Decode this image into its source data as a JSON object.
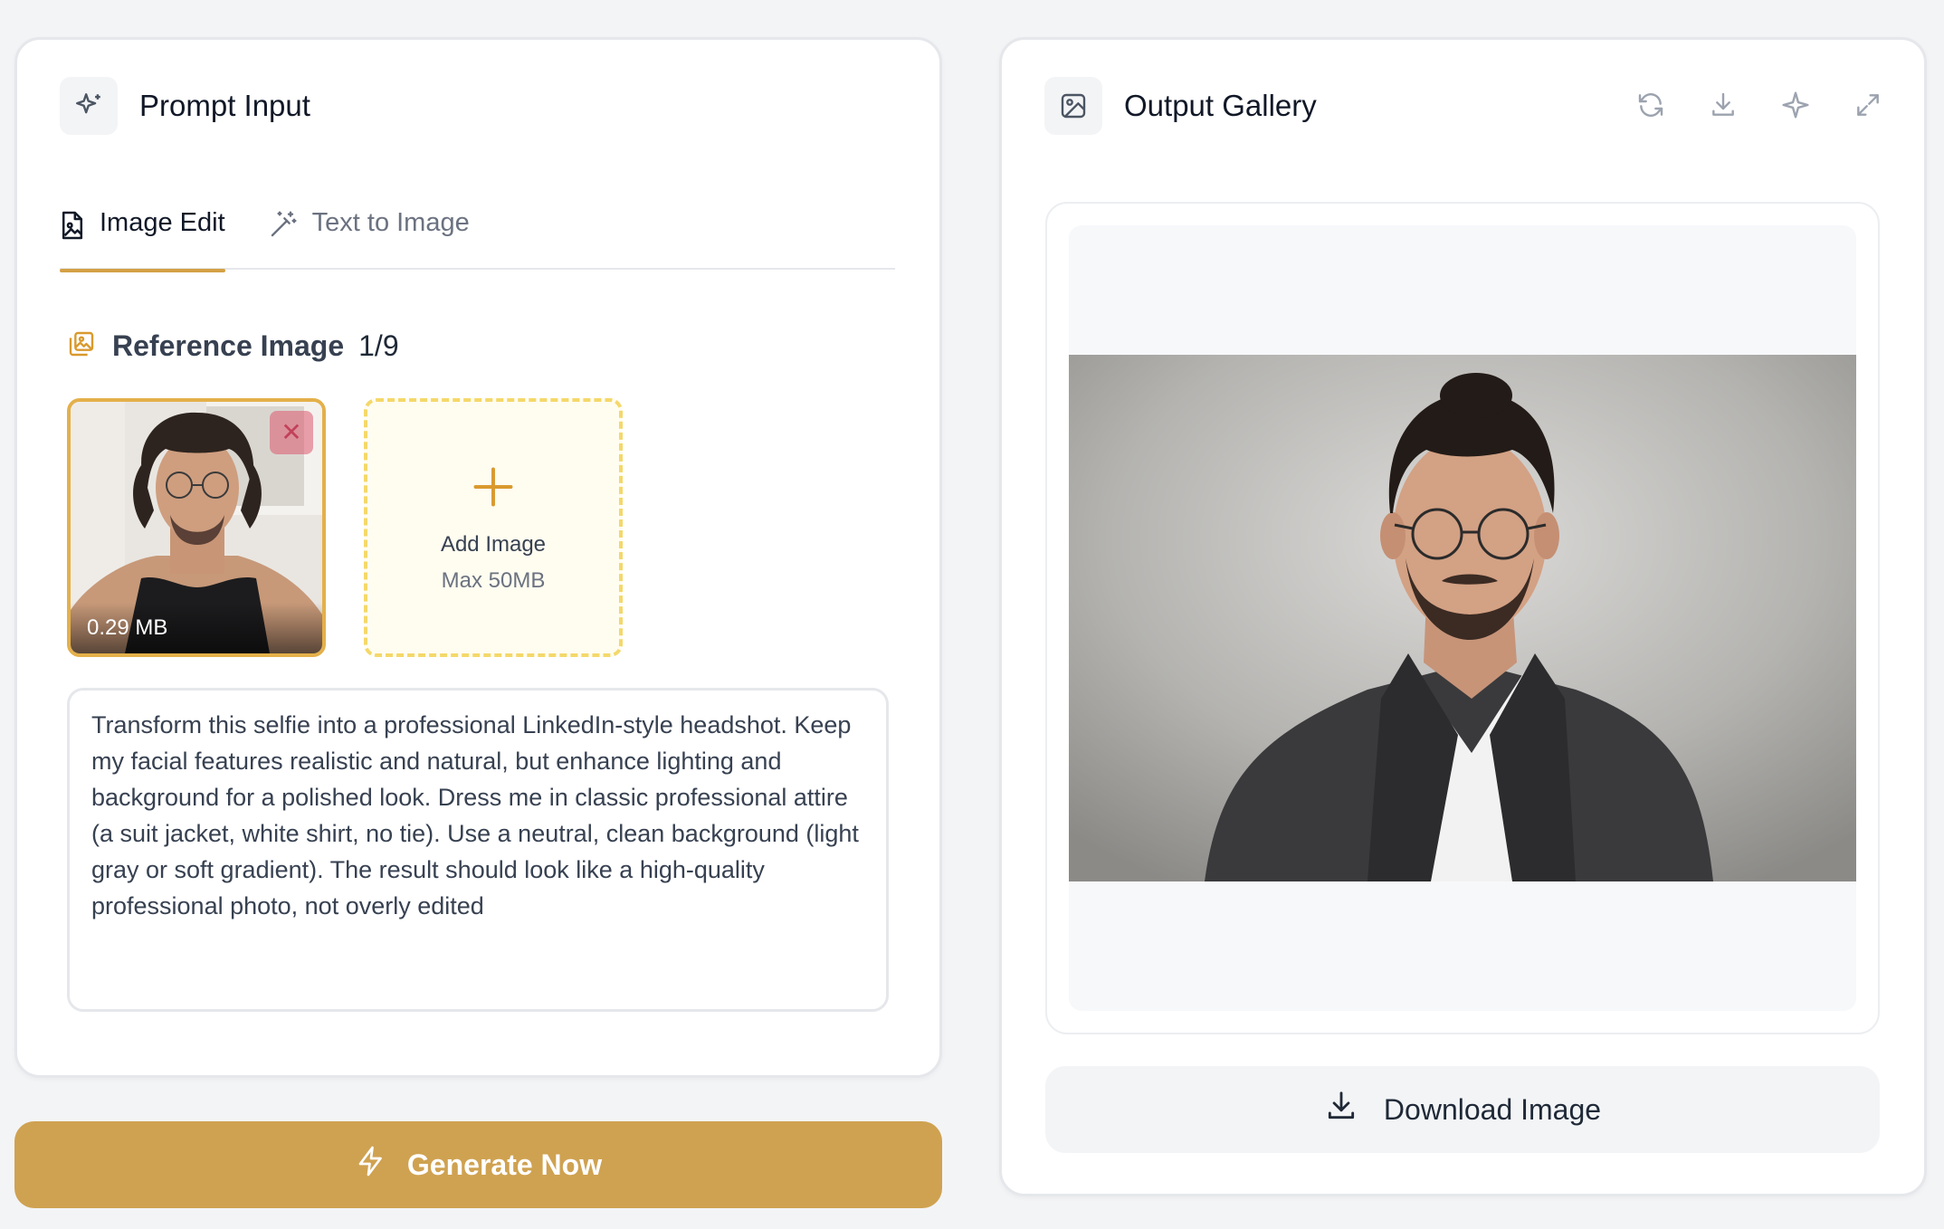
{
  "left_panel": {
    "title": "Prompt Input",
    "icon": "sparkles-icon",
    "tabs": [
      {
        "label": "Image Edit",
        "icon": "image-file-icon",
        "active": true
      },
      {
        "label": "Text to Image",
        "icon": "magic-wand-icon",
        "active": false
      }
    ],
    "reference": {
      "title": "Reference Image",
      "count": "1/9",
      "icon": "images-icon",
      "thumbnail": {
        "size_label": "0.29 MB",
        "remove_icon": "close-icon"
      },
      "add_image": {
        "label": "Add Image",
        "sublabel": "Max 50MB",
        "icon": "plus-icon"
      }
    },
    "prompt_text": "Transform this selfie into a professional LinkedIn-style headshot. Keep my facial features realistic and natural, but enhance lighting and background for a polished look. Dress me in classic professional attire (a suit jacket, white shirt, no tie). Use a neutral, clean background (light gray or soft gradient). The result should look like a high-quality professional photo, not overly edited",
    "generate_button": {
      "label": "Generate Now",
      "icon": "lightning-icon"
    }
  },
  "right_panel": {
    "title": "Output Gallery",
    "icon": "image-icon",
    "actions": [
      "refresh-icon",
      "download-icon",
      "sparkle-icon",
      "expand-icon"
    ],
    "download_button": {
      "label": "Download Image",
      "icon": "download-icon"
    }
  },
  "colors": {
    "accent": "#cfa251",
    "accent_border": "#e4b04a",
    "dashed_border": "#f4d86a",
    "page_bg": "#f3f4f6"
  }
}
